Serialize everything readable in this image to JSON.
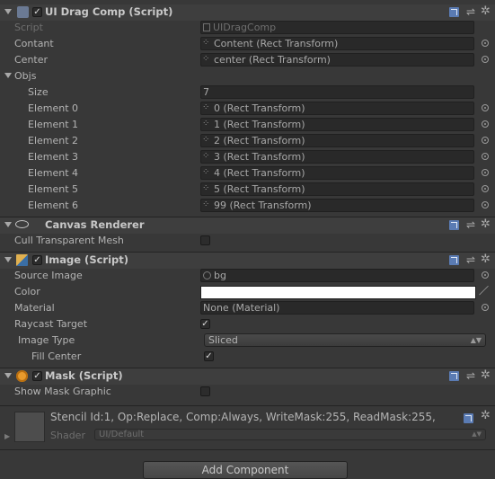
{
  "drag_comp": {
    "title": "UI Drag Comp (Script)",
    "script_label": "Script",
    "script_value": "UIDragComp",
    "contant_label": "Contant",
    "contant_value": "Content (Rect Transform)",
    "center_label": "Center",
    "center_value": "center (Rect Transform)",
    "objs_label": "Objs",
    "size_label": "Size",
    "size_value": "7",
    "elements": [
      {
        "label": "Element 0",
        "value": "0 (Rect Transform)"
      },
      {
        "label": "Element 1",
        "value": "1 (Rect Transform)"
      },
      {
        "label": "Element 2",
        "value": "2 (Rect Transform)"
      },
      {
        "label": "Element 3",
        "value": "3 (Rect Transform)"
      },
      {
        "label": "Element 4",
        "value": "4 (Rect Transform)"
      },
      {
        "label": "Element 5",
        "value": "5 (Rect Transform)"
      },
      {
        "label": "Element 6",
        "value": "99 (Rect Transform)"
      }
    ]
  },
  "canvas_renderer": {
    "title": "Canvas Renderer",
    "cull_label": "Cull Transparent Mesh",
    "cull_checked": false
  },
  "image": {
    "title": "Image (Script)",
    "source_label": "Source Image",
    "source_value": "bg",
    "color_label": "Color",
    "color_value": "#ffffff",
    "material_label": "Material",
    "material_value": "None (Material)",
    "raycast_label": "Raycast Target",
    "raycast_checked": true,
    "image_type_label": "Image Type",
    "image_type_value": "Sliced",
    "fill_center_label": "Fill Center",
    "fill_center_checked": true
  },
  "mask": {
    "title": "Mask (Script)",
    "show_graphic_label": "Show Mask Graphic",
    "show_graphic_checked": false
  },
  "material_preview": {
    "stencil_text": "Stencil Id:1, Op:Replace, Comp:Always, WriteMask:255, ReadMask:255,",
    "shader_label": "Shader",
    "shader_value": "UI/Default"
  },
  "add_component_label": "Add Component",
  "icons": {
    "help": "help-book-icon",
    "presets": "presets-icon",
    "settings": "gear-icon",
    "object_picker": "object-picker-icon"
  }
}
